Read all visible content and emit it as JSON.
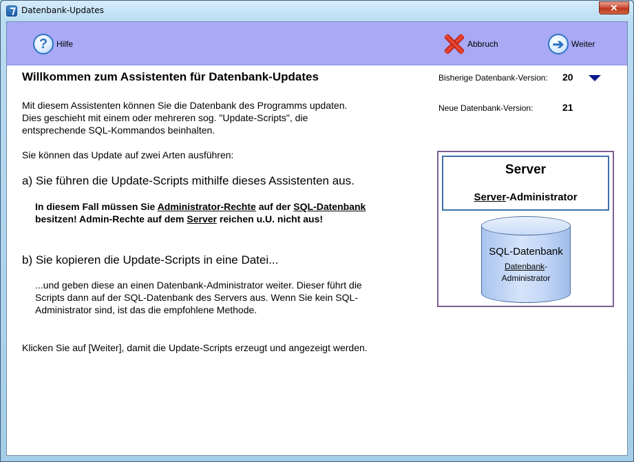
{
  "window": {
    "title": "Datenbank-Updates",
    "close_glyph": "✕"
  },
  "toolbar": {
    "help_label": "Hilfe",
    "help_icon": "question-icon",
    "cancel_label": "Abbruch",
    "cancel_icon": "red-x-icon",
    "next_label": "Weiter",
    "next_icon": "arrow-right-icon",
    "background": "#a9a9f5"
  },
  "main": {
    "heading": "Willkommen zum Assistenten für Datenbank-Updates",
    "intro_line1": "Mit diesem Assistenten können Sie die Datenbank des Programms updaten.",
    "intro_line2": "Dies geschieht mit einem oder mehreren sog. \"Update-Scripts\", die",
    "intro_line3": "entsprechende SQL-Kommandos beinhalten.",
    "ways": "Sie können das Update auf zwei Arten ausführen:",
    "option_a": "a) Sie führen die Update-Scripts mithilfe dieses Assistenten aus.",
    "note_a1_pre": "In diesem Fall müssen Sie",
    "note_a1_u1": "Administrator-Rechte",
    "note_a1_mid": "auf der",
    "note_a1_u2": "SQL-Datenbank",
    "note_a2_pre": "besitzen! Admin-Rechte auf dem",
    "note_a2_u": "Server",
    "note_a2_post": "reichen u.U. nicht aus!",
    "option_b": "b) Sie kopieren die Update-Scripts in eine Datei...",
    "note_b1": "...und geben diese an einen Datenbank-Administrator weiter. Dieser führt die",
    "note_b2": "Scripts dann auf der SQL-Datenbank des Servers aus. Wenn Sie kein SQL-",
    "note_b3": "Administrator sind, ist das die empfohlene Methode.",
    "footer": "Klicken Sie auf [Weiter], damit die Update-Scripts erzeugt und angezeigt werden."
  },
  "versions": {
    "current_label": "Bisherige Datenbank-Version:",
    "current_value": "20",
    "new_label": "Neue Datenbank-Version:",
    "new_value": "21"
  },
  "diagram": {
    "server_title": "Server",
    "server_admin_u": "Server",
    "server_admin_rest": "-Administrator",
    "db_title": "SQL-Datenbank",
    "db_admin_u": "Datenbank",
    "db_admin_dash": "-",
    "db_admin_line2": "Administrator"
  }
}
